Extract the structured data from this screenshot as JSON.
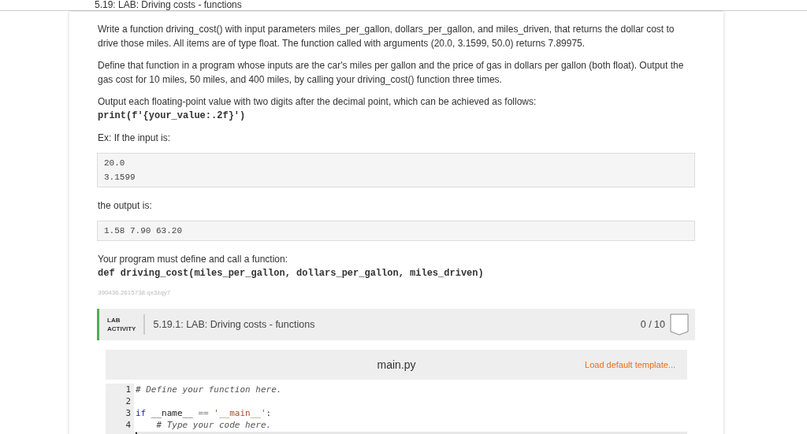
{
  "header": {
    "title": "5.19: LAB: Driving costs - functions"
  },
  "instructions": {
    "paragraphs": [
      {
        "kind": "text",
        "text": "Write a function driving_cost() with input parameters miles_per_gallon, dollars_per_gallon, and miles_driven, that returns the dollar cost to drive those miles. All items are of type float. The function called with arguments (20.0, 3.1599, 50.0) returns 7.89975."
      },
      {
        "kind": "text",
        "text": "Define that function in a program whose inputs are the car's miles per gallon and the price of gas in dollars per gallon (both float). Output the gas cost for 10 miles, 50 miles, and 400 miles, by calling your driving_cost() function three times."
      },
      {
        "kind": "text_code",
        "text": "Output each floating-point value with two digits after the decimal point, which can be achieved as follows:",
        "code": "print(f'{your_value:.2f}')"
      },
      {
        "kind": "text",
        "text": "Ex: If the input is:"
      },
      {
        "kind": "block",
        "lines": [
          "20.0",
          "3.1599"
        ]
      },
      {
        "kind": "text",
        "text": "the output is:"
      },
      {
        "kind": "block",
        "lines": [
          "1.58 7.90 63.20"
        ]
      },
      {
        "kind": "text_code",
        "text": "Your program must define and call a function:",
        "code": "def driving_cost(miles_per_gallon, dollars_per_gallon, miles_driven)"
      },
      {
        "kind": "id",
        "text": "390436.2615738.qx3zqy7"
      }
    ]
  },
  "lab": {
    "label_top": "LAB",
    "label_bottom": "ACTIVITY",
    "title": "5.19.1: LAB: Driving costs - functions",
    "score": "0 / 10",
    "editor": {
      "filename": "main.py",
      "template_link": "Load default template...",
      "lines": [
        {
          "number": "1",
          "current": false,
          "tokens": [
            {
              "kind": "comment",
              "text": "# Define your function here."
            }
          ]
        },
        {
          "number": "2",
          "current": false
        },
        {
          "number": "3",
          "current": false,
          "tokens": [
            {
              "kind": "keyword",
              "text": "if"
            },
            {
              "kind": "plain",
              "text": " __name__ "
            },
            {
              "kind": "operator",
              "text": "== "
            },
            {
              "kind": "string",
              "text": "'__main__'"
            },
            {
              "kind": "plain",
              "text": ":"
            }
          ]
        },
        {
          "number": "4",
          "current": false,
          "tokens": [
            {
              "kind": "comment",
              "text": "    # Type your code here."
            }
          ]
        },
        {
          "current": true
        }
      ]
    }
  }
}
